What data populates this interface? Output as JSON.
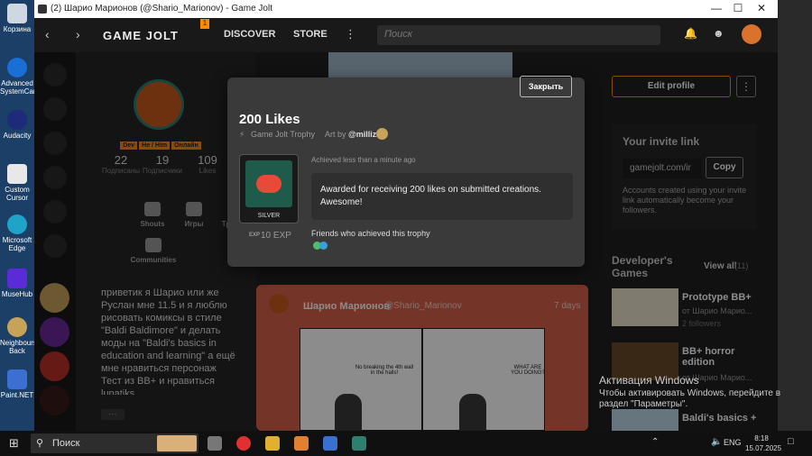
{
  "desktop": {
    "icons": [
      {
        "label": "Корзина"
      },
      {
        "label": "Advanced SystemCare"
      },
      {
        "label": "Audacity"
      },
      {
        "label": "Custom Cursor"
      },
      {
        "label": "Microsoft Edge"
      },
      {
        "label": "MuseHub"
      },
      {
        "label": "Neighbours Back Fro..."
      },
      {
        "label": "Paint.NET"
      }
    ]
  },
  "window": {
    "tab_title": "(2) Шарио Марионов (@Shario_Marionov) - Game Jolt"
  },
  "navbar": {
    "logo": "GAME JOLT",
    "badge": "1",
    "discover": "DISCOVER",
    "store": "STORE",
    "search_placeholder": "Поиск"
  },
  "profile": {
    "tags": [
      "Dev",
      "He / Him",
      "Онлайн"
    ],
    "stats": [
      {
        "value": "22",
        "label": "Подписаны"
      },
      {
        "value": "19",
        "label": "Подписчики"
      },
      {
        "value": "109",
        "label": "Likes"
      }
    ],
    "nav": [
      {
        "label": "Shouts",
        "icon": "shouts-icon"
      },
      {
        "label": "Игры",
        "icon": "gamepad-icon"
      },
      {
        "label": "Трофеи",
        "icon": "trophy-icon"
      },
      {
        "label": "Communities",
        "icon": "communities-icon"
      }
    ],
    "bio": "приветик я Шарио или же Руслан мне 11.5 и я люблю рисовать комиксы в стиле \"Baldi Baldimore\" и делать моды на \"Baldi's basics in education and learning\" а ещё мне нравиться персонаж Тест из BB+ и нравиться lunatiks",
    "more": "···"
  },
  "post": {
    "author": "Шарио Марионов",
    "handle": "@Shario_Marionov",
    "age": "7 days",
    "comic_bubble_left": "No breaking the 4th wall in the halls!",
    "comic_bubble_right": "WHAT ARE YOU DOING?"
  },
  "right": {
    "edit_profile": "Edit profile",
    "invite_title": "Your invite link",
    "invite_link": "gamejolt.com/ir",
    "copy": "Copy",
    "invite_desc": "Accounts created using your invite link automatically become your followers.",
    "dev_games_title": "Developer's Games",
    "view_all": "View all",
    "view_all_count": "(11)",
    "games": [
      {
        "title": "Prototype BB+",
        "by": "от Шарио Марио...",
        "meta": "2 followers"
      },
      {
        "title": "BB+ horror edition",
        "by": "от Шарио Марио...",
        "meta": ""
      },
      {
        "title": "Baldi's basics +",
        "by": "",
        "meta": ""
      }
    ]
  },
  "modal": {
    "close": "Закрыть",
    "title": "200 Likes",
    "subtitle": "Game Jolt Trophy",
    "art_by": "Art by",
    "artist": "@millizz",
    "tier": "SILVER",
    "exp": "10 EXP",
    "exp_badge": "EXP",
    "achieved": "Achieved less than a minute ago",
    "description": "Awarded for receiving 200 likes on submitted creations. Awesome!",
    "friends_title": "Friends who achieved this trophy"
  },
  "taskbar": {
    "search": "Поиск",
    "lang": "ENG",
    "time": "8:18",
    "date": "15.07.2025"
  },
  "watermark": {
    "title": "Активация Windows",
    "text": "Чтобы активировать Windows, перейдите в раздел \"Параметры\"."
  },
  "colors": {
    "accent": "#ff8a00",
    "jolt_green": "#2f7f6f",
    "modal_bg": "#3a3a3a"
  }
}
